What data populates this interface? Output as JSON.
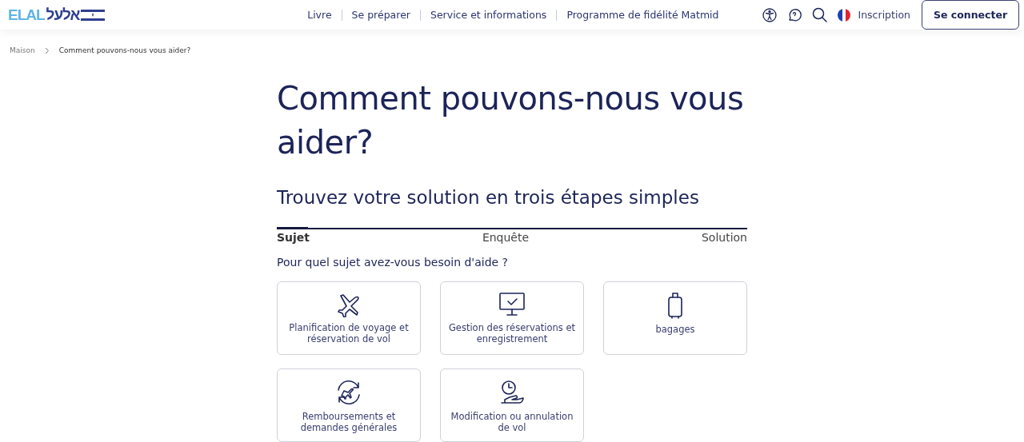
{
  "header": {
    "logo": {
      "latin": "ELAL",
      "hebrew": "אלעל"
    },
    "nav": [
      "Livre",
      "Se préparer",
      "Service et informations",
      "Programme de fidélité Matmid"
    ],
    "signup": "Inscription",
    "login": "Se connecter"
  },
  "breadcrumb": [
    "Maison",
    "Comment pouvons-nous vous aider?"
  ],
  "title": "Comment pouvons-nous vous aider?",
  "subtitle": "Trouvez votre solution en trois étapes simples",
  "stepper": {
    "level": 0.066,
    "steps": [
      {
        "label": "Sujet",
        "selected": true
      },
      {
        "label": "Enquête",
        "selected": false
      },
      {
        "label": "Solution",
        "selected": false
      }
    ]
  },
  "question": "Pour quel sujet avez-vous besoin d'aide ?",
  "topics": [
    {
      "kind": "plane",
      "label": "Planification de voyage et réservation de vol"
    },
    {
      "kind": "monitor",
      "label": "Gestion des réservations et enregistrement"
    },
    {
      "kind": "luggage",
      "label": "bagages"
    },
    {
      "kind": "refund",
      "label": "Remboursements et demandes générales"
    },
    {
      "kind": "clock",
      "label": "Modification ou annulation de vol"
    }
  ]
}
